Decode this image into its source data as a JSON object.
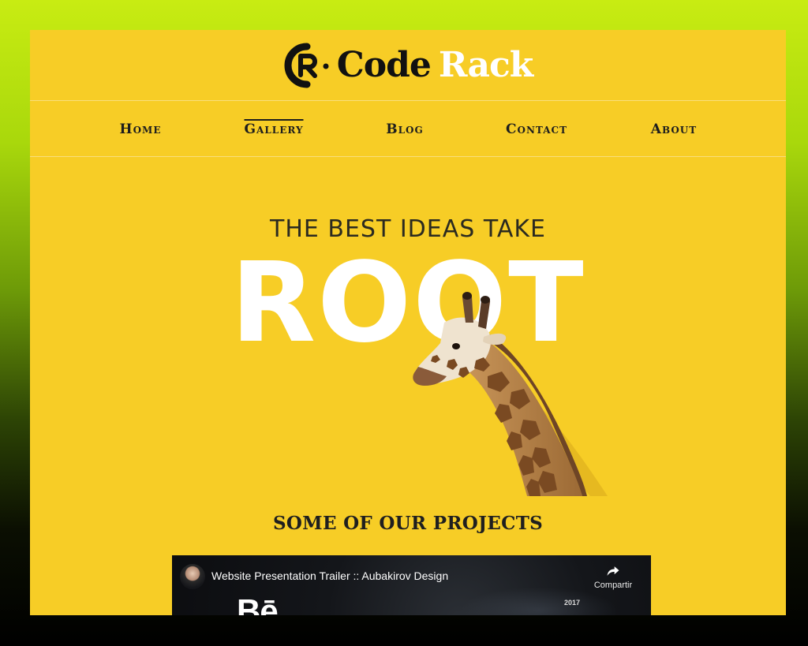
{
  "header": {
    "logo_mark": "CR",
    "logo_word_1": "Code",
    "logo_word_2": "Rack"
  },
  "nav": {
    "items": [
      {
        "label": "Home",
        "active": false
      },
      {
        "label": "Gallery",
        "active": true
      },
      {
        "label": "Blog",
        "active": false
      },
      {
        "label": "Contact",
        "active": false
      },
      {
        "label": "About",
        "active": false
      }
    ]
  },
  "hero": {
    "subtitle": "THE BEST IDEAS TAKE",
    "title": "ROOT"
  },
  "projects": {
    "heading": "SOME OF OUR PROJECTS"
  },
  "video": {
    "title": "Website Presentation Trailer :: Aubakirov Design",
    "share_label": "Compartir",
    "brand_text": "Bē",
    "year": "2017"
  },
  "colors": {
    "page_background": "#f7cd26",
    "accent_white": "#ffffff",
    "text_dark": "#1d1d1d",
    "outer_gradient_top": "#c8ec12",
    "outer_gradient_bottom": "#000000"
  },
  "icons": {
    "logo": "cr-logo-icon",
    "share": "share-arrow-icon"
  }
}
